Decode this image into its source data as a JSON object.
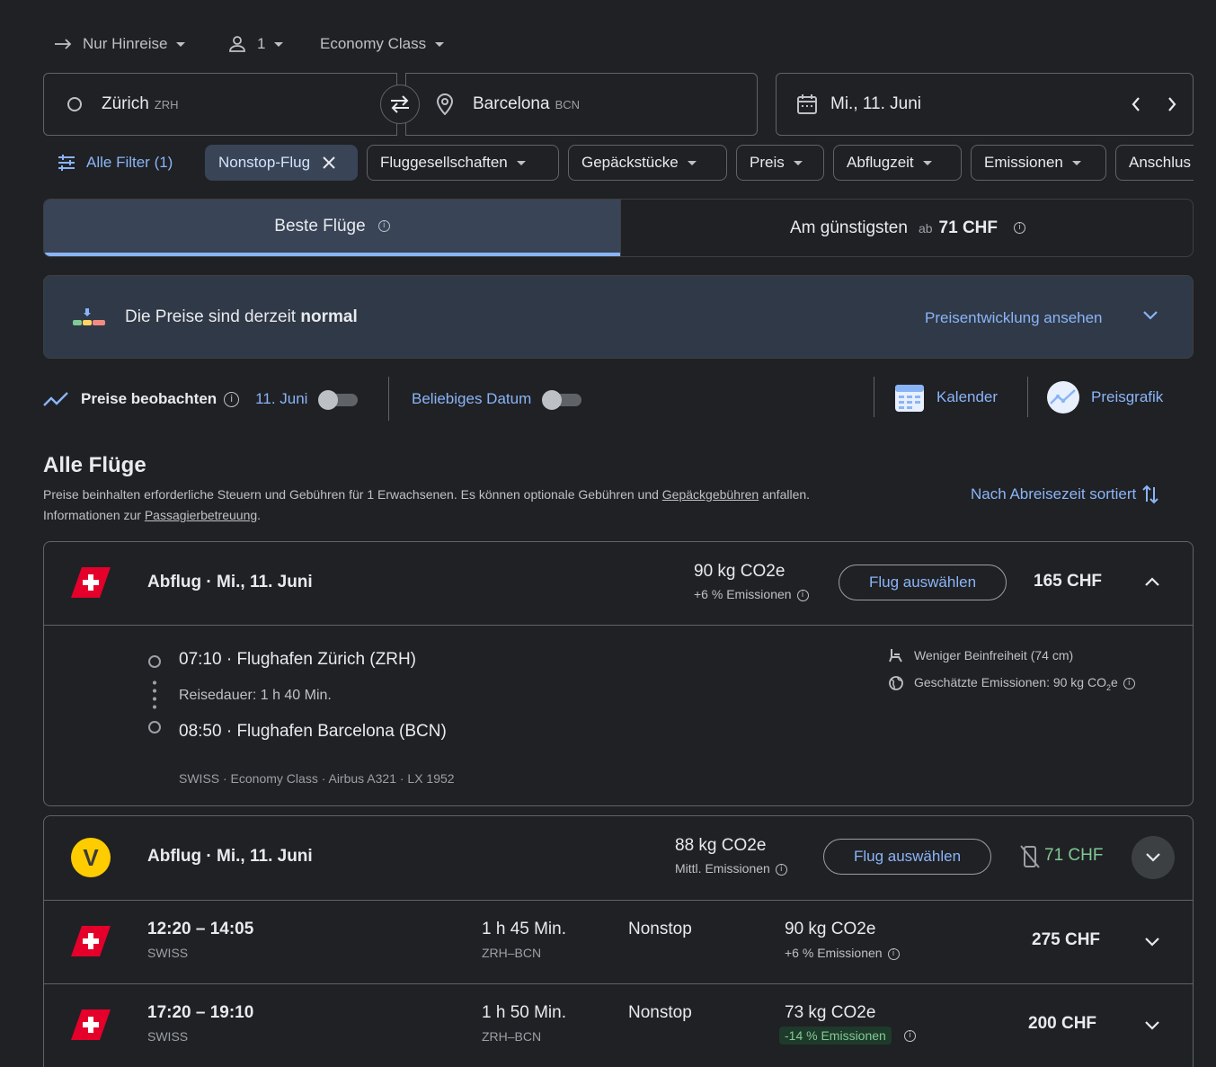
{
  "top": {
    "trip_type": "Nur Hinreise",
    "passengers": "1",
    "cabin": "Economy Class"
  },
  "search": {
    "origin_city": "Zürich",
    "origin_code": "ZRH",
    "destination_city": "Barcelona",
    "destination_code": "BCN",
    "date": "Mi., 11. Juni"
  },
  "filters": {
    "all_filters": "Alle Filter (1)",
    "chips": [
      "Nonstop-Flug",
      "Fluggesellschaften",
      "Gepäckstücke",
      "Preis",
      "Abflugzeit",
      "Emissionen",
      "Anschlus"
    ]
  },
  "tabs": {
    "best": "Beste Flüge",
    "cheapest": "Am günstigsten",
    "cheapest_prefix": "ab",
    "cheapest_price": "71 CHF"
  },
  "insight": {
    "text_prefix": "Die Preise sind derzeit",
    "text_bold": "normal",
    "link": "Preisentwicklung ansehen"
  },
  "tracking": {
    "label": "Preise beobachten",
    "date": "11. Juni",
    "any_date": "Beliebiges Datum",
    "calendar": "Kalender",
    "price_graph": "Preisgrafik"
  },
  "results": {
    "title": "Alle Flüge",
    "note_1a": "Preise beinhalten erforderliche Steuern und Gebühren für 1 Erwachsenen. Es können optionale Gebühren und",
    "note_1_link": "Gepäckgebühren",
    "note_1b": "anfallen.",
    "note_2a": "Informationen zur",
    "note_2_link": "Passagierbetreuung",
    "note_2b": ".",
    "sort": "Nach Abreisezeit sortiert"
  },
  "flight1": {
    "label": "Abflug",
    "date": "Mi., 11. Juni",
    "co2": "90 kg CO2e",
    "co2_note": "+6 % Emissionen",
    "select": "Flug auswählen",
    "price": "165 CHF",
    "dep_time": "07:10",
    "dep_airport": "Flughafen Zürich (ZRH)",
    "duration": "Reisedauer: 1 h 40 Min.",
    "arr_time": "08:50",
    "arr_airport": "Flughafen Barcelona (BCN)",
    "details": "SWISS · Economy Class · Airbus A321 · LX 1952",
    "legroom": "Weniger Beinfreiheit (74 cm)",
    "emissions_est_a": "Geschätzte Emissionen: 90 kg CO",
    "emissions_est_sub": "2",
    "emissions_est_b": "e"
  },
  "flight2": {
    "label": "Abflug",
    "date": "Mi., 11. Juni",
    "co2": "88 kg CO2e",
    "co2_note": "Mittl. Emissionen",
    "select": "Flug auswählen",
    "price": "71 CHF",
    "logo_letter": "V"
  },
  "flight3": {
    "times": "12:20 – 14:05",
    "airline": "SWISS",
    "duration": "1 h 45 Min.",
    "route": "ZRH–BCN",
    "stops": "Nonstop",
    "co2": "90 kg CO2e",
    "co2_note": "+6 % Emissionen",
    "price": "275 CHF"
  },
  "flight4": {
    "times": "17:20 – 19:10",
    "airline": "SWISS",
    "duration": "1 h 50 Min.",
    "route": "ZRH–BCN",
    "stops": "Nonstop",
    "co2": "73 kg CO2e",
    "co2_note": "-14 % Emissionen",
    "price": "200 CHF"
  },
  "colors": {
    "background": "#202124",
    "accent": "#8ab4f8",
    "selected_tab": "#394457",
    "low_price": "#81c995",
    "swiss_red": "#e4002b",
    "vueling_yellow": "#ffcc00"
  },
  "icons": [
    "arrow-right-icon",
    "person-icon",
    "circle-origin-icon",
    "swap-icon",
    "location-pin-icon",
    "calendar-icon",
    "chevron-left-icon",
    "chevron-right-icon",
    "filter-sliders-icon",
    "close-icon",
    "info-icon",
    "price-bars-icon",
    "chevron-down-icon",
    "trend-line-icon",
    "calendar-grid-icon",
    "price-graph-icon",
    "sort-arrows-icon",
    "swiss-logo-icon",
    "vueling-logo-icon",
    "seat-icon",
    "globe-icon",
    "no-mobile-icon",
    "chevron-up-icon"
  ]
}
